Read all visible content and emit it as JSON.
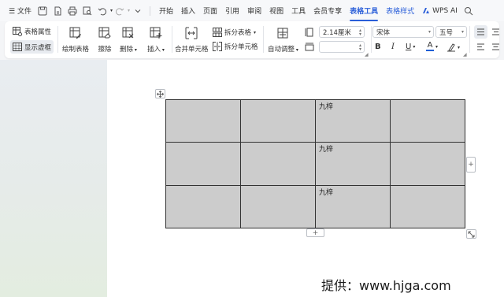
{
  "menubar": {
    "file": "文件",
    "tabs": [
      "开始",
      "插入",
      "页面",
      "引用",
      "审阅",
      "视图",
      "工具",
      "会员专享"
    ],
    "table_tools": "表格工具",
    "table_style": "表格样式",
    "wps_ai": "WPS AI"
  },
  "ribbon": {
    "table_props": "表格属性",
    "show_gridlines": "显示虚框",
    "draw_table": "绘制表格",
    "erase": "擦除",
    "delete": "删除",
    "insert": "插入",
    "split_table": "拆分表格",
    "merge_cells": "合并单元格",
    "split_cells": "拆分单元格",
    "auto_adjust": "自动调整",
    "height_value": "2.14厘米",
    "width_value": "",
    "font_name": "宋体",
    "font_size": "五号",
    "bold": "B",
    "italic": "I",
    "underline": "U",
    "font_color": "A"
  },
  "table": {
    "rows": [
      [
        "",
        "",
        "九梓",
        ""
      ],
      [
        "",
        "",
        "九梓",
        ""
      ],
      [
        "",
        "",
        "九梓",
        ""
      ]
    ]
  },
  "watermark": "提供：www.hjga.com",
  "colors": {
    "accent": "#2b5fd9",
    "cell_fill": "#cccccc",
    "font_color_bar": "#1f5fd6"
  }
}
